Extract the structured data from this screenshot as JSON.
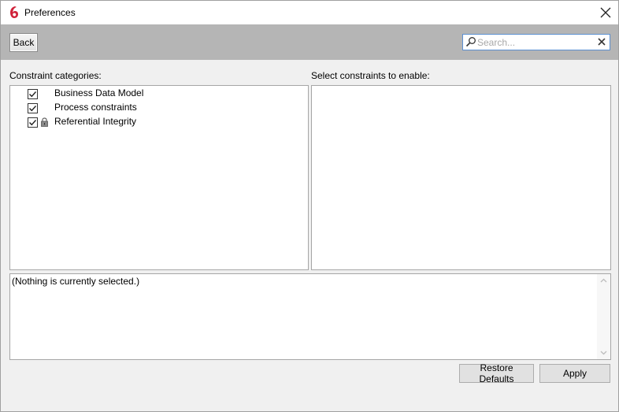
{
  "window": {
    "title": "Preferences",
    "logo_icon": "app-logo-icon",
    "close_icon": "close-icon"
  },
  "toolbar": {
    "back_label": "Back",
    "search": {
      "value": "",
      "placeholder": "Search...",
      "icon": "search-icon",
      "clear_icon": "clear-icon"
    }
  },
  "categories": {
    "label": "Constraint categories:",
    "items": [
      {
        "label": "Business Data Model",
        "checked": true,
        "locked": false
      },
      {
        "label": "Process constraints",
        "checked": true,
        "locked": false
      },
      {
        "label": "Referential Integrity",
        "checked": true,
        "locked": true
      }
    ]
  },
  "constraints": {
    "label": "Select constraints to enable:",
    "items": []
  },
  "description": {
    "text": "(Nothing is currently selected.)"
  },
  "footer": {
    "restore_label": "Restore Defaults",
    "apply_label": "Apply"
  },
  "colors": {
    "toolbar_bg": "#b5b5b5",
    "logo_red": "#d0223a",
    "focus_border": "#5b8fd1"
  }
}
